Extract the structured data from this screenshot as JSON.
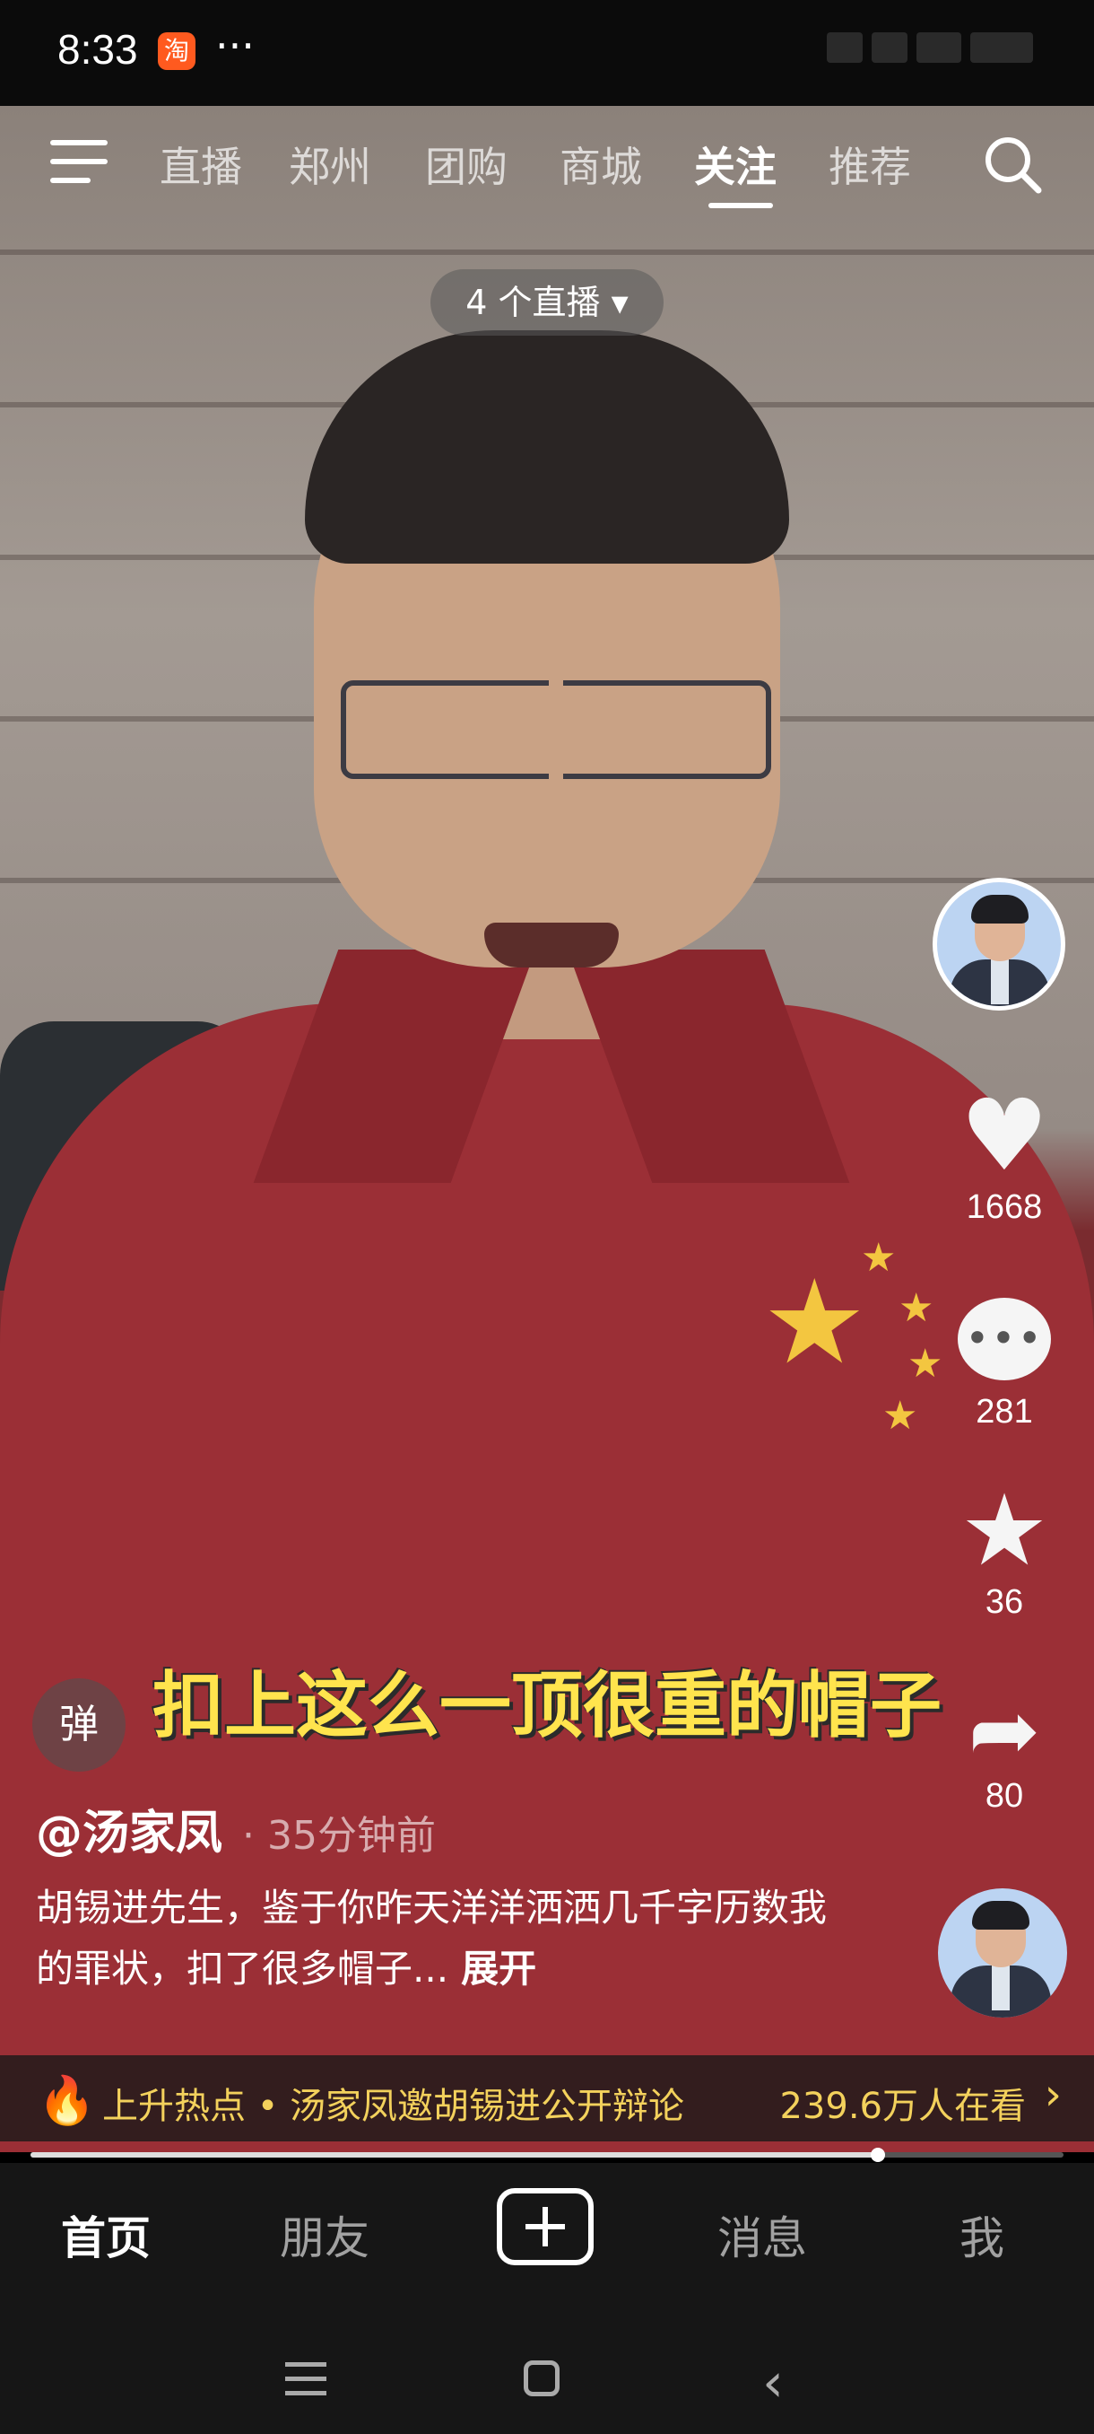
{
  "status_bar": {
    "time": "8:33",
    "app_badge": "淘",
    "more": "···"
  },
  "top_nav": {
    "tabs": [
      "直播",
      "郑州",
      "团购",
      "商城",
      "关注",
      "推荐"
    ],
    "active_tab": "关注"
  },
  "live_pill": "4 个直播 ▾",
  "actions": {
    "like_count": "1668",
    "comment_count": "281",
    "favorite_count": "36",
    "share_count": "80"
  },
  "subtitle": "扣上这么一顶很重的帽子",
  "danmaku_label": "弹",
  "post": {
    "author": "@汤家凤",
    "time_ago": "· 35分钟前",
    "description": "胡锡进先生，鉴于你昨天洋洋洒洒几千字历数我的罪状，扣了很多帽子...",
    "expand_label": "展开"
  },
  "hot_bar": {
    "topic": "上升热点 • 汤家凤邀胡锡进公开辩论",
    "viewers": "239.6万人在看"
  },
  "progress": {
    "fraction": 0.82
  },
  "bottom_nav": [
    "首页",
    "朋友",
    "消息",
    "我"
  ],
  "active_bottom": "首页",
  "colors": {
    "subtitle": "#ffe44d",
    "hot_text": "#f3d15c",
    "fire": "#ff6a22"
  }
}
